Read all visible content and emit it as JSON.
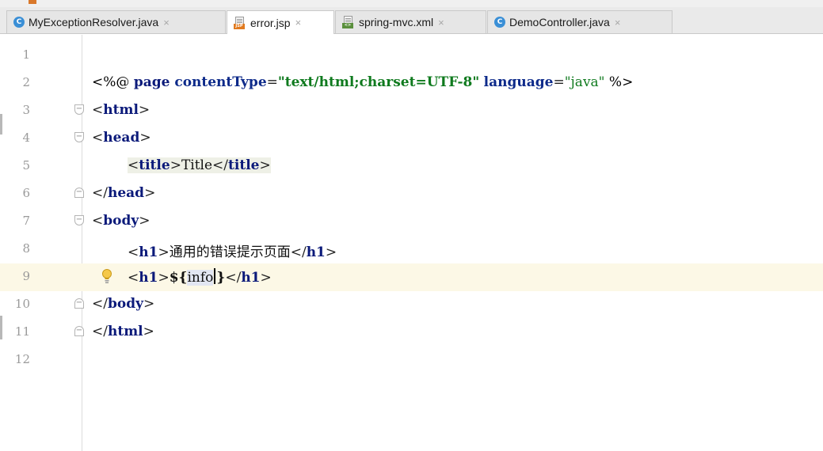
{
  "tabs": [
    {
      "label": "MyExceptionResolver.java",
      "icon": "java-class-icon",
      "active": false
    },
    {
      "label": "error.jsp",
      "icon": "jsp-file-icon",
      "active": true
    },
    {
      "label": "spring-mvc.xml",
      "icon": "xml-file-icon",
      "active": false
    },
    {
      "label": "DemoController.java",
      "icon": "java-class-icon",
      "active": false
    }
  ],
  "tab_close_glyph": "×",
  "editor": {
    "line_numbers": [
      "1",
      "2",
      "3",
      "4",
      "5",
      "6",
      "7",
      "8",
      "9",
      "10",
      "11",
      "12"
    ],
    "current_line": 9,
    "lines": {
      "l2": {
        "open": "<%@ ",
        "page": "page ",
        "attr1": "contentType",
        "eq1": "=",
        "val1": "\"text/html;charset=UTF-8\"",
        "sp": " ",
        "attr2": "language",
        "eq2": "=",
        "val2": "\"java\"",
        "close": " %>"
      },
      "l3": {
        "lt": "<",
        "tag": "html",
        "gt": ">"
      },
      "l4": {
        "lt": "<",
        "tag": "head",
        "gt": ">"
      },
      "l5": {
        "lt1": "<",
        "tag1": "title",
        "gt1": ">",
        "text": "Title",
        "lt2": "</",
        "tag2": "title",
        "gt2": ">"
      },
      "l6": {
        "lt": "</",
        "tag": "head",
        "gt": ">"
      },
      "l7": {
        "lt": "<",
        "tag": "body",
        "gt": ">"
      },
      "l8": {
        "lt1": "<",
        "tag1": "h1",
        "gt1": ">",
        "text": "通用的错误提示页面",
        "lt2": "</",
        "tag2": "h1",
        "gt2": ">"
      },
      "l9": {
        "lt1": "<",
        "tag1": "h1",
        "gt1": ">",
        "el_open": "${",
        "el_var_before": "info",
        "el_close": "}",
        "lt2": "</",
        "tag2": "h1",
        "gt2": ">"
      },
      "l10": {
        "lt": "</",
        "tag": "body",
        "gt": ">"
      },
      "l11": {
        "lt": "</",
        "tag": "html",
        "gt": ">"
      }
    }
  },
  "colors": {
    "current_line_bg": "#fcf8e6",
    "tag": "#0b1a7a",
    "string": "#0f7a1e",
    "line_number": "#9a9a9a"
  }
}
